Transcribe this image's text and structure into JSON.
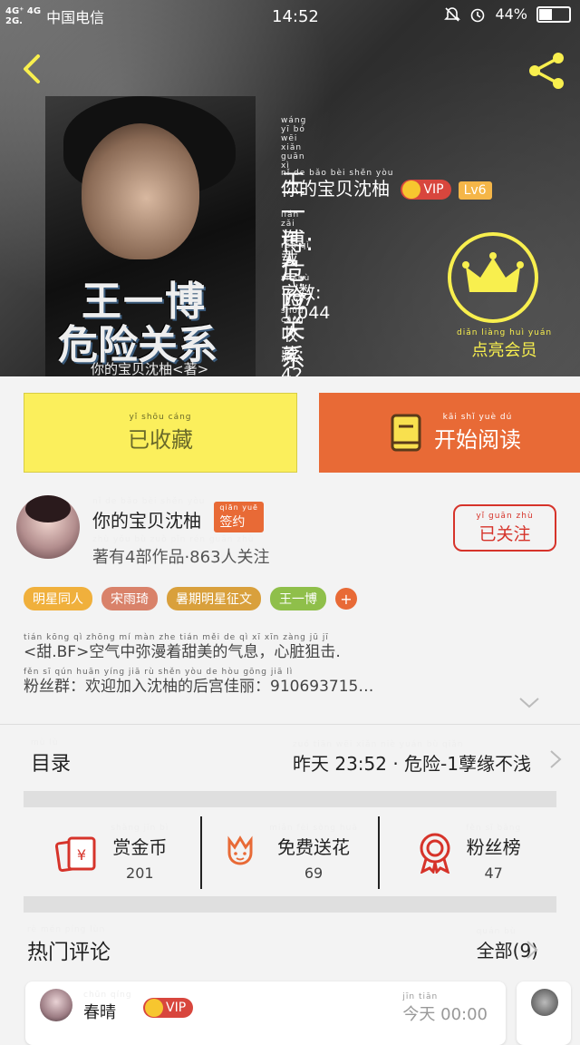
{
  "status_bar": {
    "network_top": "4G⁺ 4G",
    "network_bottom": "2G.",
    "carrier": "中国电信",
    "time": "14:52",
    "battery": "44%"
  },
  "book": {
    "title_pinyin": "wáng yī bó wēi xiǎn guān xì",
    "title": "王一博:危险关系",
    "cover_title_line1": "王一博",
    "cover_title_line2": "危险关系",
    "cover_author": "你的宝贝沈柚<著>",
    "author_pinyin": "nǐ de bǎo bèi shěn yòu",
    "author": "你的宝贝沈柚",
    "vip_label": "VIP",
    "level": "Lv6",
    "status_pinyin": "lián zǎi",
    "status": "连载",
    "popularity_pinyin": "rén qì",
    "popularity": "人气: 197",
    "words_pinyin": "zì shù",
    "words": "字数: 1,044",
    "favorites_pinyin": "shōu cáng",
    "favorites": "收藏: 42",
    "member_pinyin": "diǎn liàng huì yuán",
    "member_label": "点亮会员"
  },
  "actions": {
    "fav_pinyin": "yǐ shōu cáng",
    "fav_label": "已收藏",
    "read_pinyin": "kāi shǐ yuè dú",
    "read_label": "开始阅读"
  },
  "author_card": {
    "name_pinyin": "nǐ de bǎo bèi shěn yòu",
    "name": "你的宝贝沈柚",
    "sign_pinyin": "qiān yuē",
    "sign": "签约",
    "stats_pinyin": "zhù yǒu bù zuò pǐn rén guān zhù",
    "stats": "著有4部作品·863人关注",
    "follow_pinyin": "yǐ guān zhù",
    "follow": "已关注"
  },
  "tags": [
    {
      "label": "明星同人",
      "color": "#f0b03c"
    },
    {
      "label": "宋雨琦",
      "color": "#d9826a"
    },
    {
      "label": "暑期明星征文",
      "color": "#d9a03c"
    },
    {
      "label": "王一博",
      "color": "#8fbf4a"
    }
  ],
  "tag_more": "+",
  "description": {
    "line1_pinyin": "tián   kōng qì zhōng mí màn zhe tián měi de qì xī   xīn zàng jū jī",
    "line1": "<甜.BF>空气中弥漫着甜美的气息，心脏狙击.",
    "line2_pinyin": "fěn sī qún  huān yíng jiā rù shěn yòu de hòu gōng jiā lì",
    "line2": "粉丝群：欢迎加入沈柚的后宫佳丽：910693715…"
  },
  "toc": {
    "label_pinyin": "mù lù",
    "label": "目录",
    "latest_pinyin": "zuó tiān        wēi xiǎn   niè yuán bù qiǎn",
    "latest": "昨天 23:52 · 危险-1孽缘不浅"
  },
  "stats": [
    {
      "pinyin": "shǎng jīn bì",
      "label": "赏金币",
      "value": "201",
      "icon": "red-envelope-icon"
    },
    {
      "pinyin": "miǎn fèi sòng huā",
      "label": "免费送花",
      "value": "69",
      "icon": "flower-icon"
    },
    {
      "pinyin": "fěn sī bǎng",
      "label": "粉丝榜",
      "value": "47",
      "icon": "ribbon-badge-icon"
    }
  ],
  "comments": {
    "header_pinyin": "rè mén píng lùn",
    "header": "热门评论",
    "all_pinyin": "quán bù",
    "all": "全部(9)",
    "first": {
      "name_pinyin": "chūn qíng",
      "name": "春晴",
      "vip": "VIP",
      "time_pinyin": "jīn tiān",
      "time": "今天 00:00"
    }
  },
  "colors": {
    "accent_orange": "#e86a36",
    "fav_yellow": "#fbef5c",
    "member_yellow": "#f8ef4e",
    "follow_red": "#d6332a"
  }
}
